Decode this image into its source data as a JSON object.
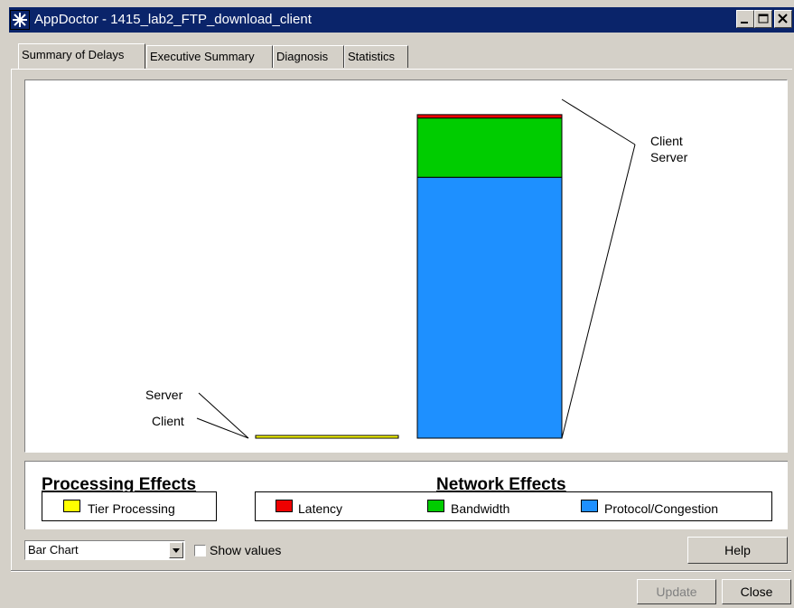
{
  "window": {
    "title": "AppDoctor - 1415_lab2_FTP_download_client",
    "icon": "asterisk-app-icon",
    "controls": {
      "minimize": "_",
      "maximize": "□",
      "close": "X"
    }
  },
  "tabs": [
    {
      "label": "Summary of Delays",
      "active": true
    },
    {
      "label": "Executive Summary",
      "active": false
    },
    {
      "label": "Diagnosis",
      "active": false
    },
    {
      "label": "Statistics",
      "active": false
    }
  ],
  "chart_data": {
    "type": "bar",
    "stacked": true,
    "categories": [
      "Processing Effects",
      "Network Effects"
    ],
    "series": [
      {
        "name": "Tier Processing",
        "color": "#ffff00",
        "values": [
          0.8,
          0
        ]
      },
      {
        "name": "Protocol/Congestion",
        "color": "#1e90ff",
        "values": [
          0,
          77
        ]
      },
      {
        "name": "Bandwidth",
        "color": "#00cc00",
        "values": [
          0,
          17.5
        ]
      },
      {
        "name": "Latency",
        "color": "#ee0000",
        "values": [
          0,
          1
        ]
      }
    ],
    "ylim": [
      0,
      100
    ],
    "grid": false,
    "annotations": {
      "processing": [
        "Server",
        "Client"
      ],
      "network": [
        "Client",
        "Server"
      ]
    }
  },
  "legend": {
    "processing_heading": "Processing Effects",
    "network_heading": "Network Effects",
    "processing_items": [
      {
        "label": "Tier Processing",
        "color": "#ffff00"
      }
    ],
    "network_items": [
      {
        "label": "Latency",
        "color": "#ee0000"
      },
      {
        "label": "Bandwidth",
        "color": "#00cc00"
      },
      {
        "label": "Protocol/Congestion",
        "color": "#1e90ff"
      }
    ]
  },
  "controls": {
    "chart_type": "Bar Chart",
    "show_values_label": "Show values",
    "show_values_checked": false,
    "help_label": "Help",
    "update_label": "Update",
    "close_label": "Close"
  },
  "colors": {
    "titlebar": "#0a246a",
    "face": "#d4d0c8"
  }
}
